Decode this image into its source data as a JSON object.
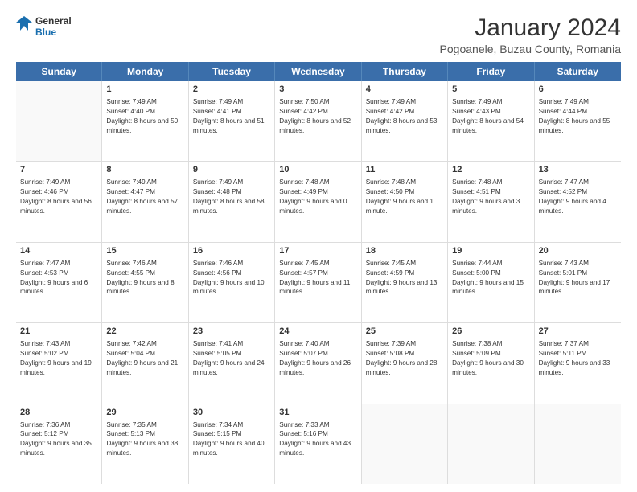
{
  "header": {
    "logo_line1": "General",
    "logo_line2": "Blue",
    "month": "January 2024",
    "location": "Pogoanele, Buzau County, Romania"
  },
  "days_of_week": [
    "Sunday",
    "Monday",
    "Tuesday",
    "Wednesday",
    "Thursday",
    "Friday",
    "Saturday"
  ],
  "weeks": [
    [
      {
        "day": "",
        "sunrise": "",
        "sunset": "",
        "daylight": ""
      },
      {
        "day": "1",
        "sunrise": "Sunrise: 7:49 AM",
        "sunset": "Sunset: 4:40 PM",
        "daylight": "Daylight: 8 hours and 50 minutes."
      },
      {
        "day": "2",
        "sunrise": "Sunrise: 7:49 AM",
        "sunset": "Sunset: 4:41 PM",
        "daylight": "Daylight: 8 hours and 51 minutes."
      },
      {
        "day": "3",
        "sunrise": "Sunrise: 7:50 AM",
        "sunset": "Sunset: 4:42 PM",
        "daylight": "Daylight: 8 hours and 52 minutes."
      },
      {
        "day": "4",
        "sunrise": "Sunrise: 7:49 AM",
        "sunset": "Sunset: 4:42 PM",
        "daylight": "Daylight: 8 hours and 53 minutes."
      },
      {
        "day": "5",
        "sunrise": "Sunrise: 7:49 AM",
        "sunset": "Sunset: 4:43 PM",
        "daylight": "Daylight: 8 hours and 54 minutes."
      },
      {
        "day": "6",
        "sunrise": "Sunrise: 7:49 AM",
        "sunset": "Sunset: 4:44 PM",
        "daylight": "Daylight: 8 hours and 55 minutes."
      }
    ],
    [
      {
        "day": "7",
        "sunrise": "Sunrise: 7:49 AM",
        "sunset": "Sunset: 4:46 PM",
        "daylight": "Daylight: 8 hours and 56 minutes."
      },
      {
        "day": "8",
        "sunrise": "Sunrise: 7:49 AM",
        "sunset": "Sunset: 4:47 PM",
        "daylight": "Daylight: 8 hours and 57 minutes."
      },
      {
        "day": "9",
        "sunrise": "Sunrise: 7:49 AM",
        "sunset": "Sunset: 4:48 PM",
        "daylight": "Daylight: 8 hours and 58 minutes."
      },
      {
        "day": "10",
        "sunrise": "Sunrise: 7:48 AM",
        "sunset": "Sunset: 4:49 PM",
        "daylight": "Daylight: 9 hours and 0 minutes."
      },
      {
        "day": "11",
        "sunrise": "Sunrise: 7:48 AM",
        "sunset": "Sunset: 4:50 PM",
        "daylight": "Daylight: 9 hours and 1 minute."
      },
      {
        "day": "12",
        "sunrise": "Sunrise: 7:48 AM",
        "sunset": "Sunset: 4:51 PM",
        "daylight": "Daylight: 9 hours and 3 minutes."
      },
      {
        "day": "13",
        "sunrise": "Sunrise: 7:47 AM",
        "sunset": "Sunset: 4:52 PM",
        "daylight": "Daylight: 9 hours and 4 minutes."
      }
    ],
    [
      {
        "day": "14",
        "sunrise": "Sunrise: 7:47 AM",
        "sunset": "Sunset: 4:53 PM",
        "daylight": "Daylight: 9 hours and 6 minutes."
      },
      {
        "day": "15",
        "sunrise": "Sunrise: 7:46 AM",
        "sunset": "Sunset: 4:55 PM",
        "daylight": "Daylight: 9 hours and 8 minutes."
      },
      {
        "day": "16",
        "sunrise": "Sunrise: 7:46 AM",
        "sunset": "Sunset: 4:56 PM",
        "daylight": "Daylight: 9 hours and 10 minutes."
      },
      {
        "day": "17",
        "sunrise": "Sunrise: 7:45 AM",
        "sunset": "Sunset: 4:57 PM",
        "daylight": "Daylight: 9 hours and 11 minutes."
      },
      {
        "day": "18",
        "sunrise": "Sunrise: 7:45 AM",
        "sunset": "Sunset: 4:59 PM",
        "daylight": "Daylight: 9 hours and 13 minutes."
      },
      {
        "day": "19",
        "sunrise": "Sunrise: 7:44 AM",
        "sunset": "Sunset: 5:00 PM",
        "daylight": "Daylight: 9 hours and 15 minutes."
      },
      {
        "day": "20",
        "sunrise": "Sunrise: 7:43 AM",
        "sunset": "Sunset: 5:01 PM",
        "daylight": "Daylight: 9 hours and 17 minutes."
      }
    ],
    [
      {
        "day": "21",
        "sunrise": "Sunrise: 7:43 AM",
        "sunset": "Sunset: 5:02 PM",
        "daylight": "Daylight: 9 hours and 19 minutes."
      },
      {
        "day": "22",
        "sunrise": "Sunrise: 7:42 AM",
        "sunset": "Sunset: 5:04 PM",
        "daylight": "Daylight: 9 hours and 21 minutes."
      },
      {
        "day": "23",
        "sunrise": "Sunrise: 7:41 AM",
        "sunset": "Sunset: 5:05 PM",
        "daylight": "Daylight: 9 hours and 24 minutes."
      },
      {
        "day": "24",
        "sunrise": "Sunrise: 7:40 AM",
        "sunset": "Sunset: 5:07 PM",
        "daylight": "Daylight: 9 hours and 26 minutes."
      },
      {
        "day": "25",
        "sunrise": "Sunrise: 7:39 AM",
        "sunset": "Sunset: 5:08 PM",
        "daylight": "Daylight: 9 hours and 28 minutes."
      },
      {
        "day": "26",
        "sunrise": "Sunrise: 7:38 AM",
        "sunset": "Sunset: 5:09 PM",
        "daylight": "Daylight: 9 hours and 30 minutes."
      },
      {
        "day": "27",
        "sunrise": "Sunrise: 7:37 AM",
        "sunset": "Sunset: 5:11 PM",
        "daylight": "Daylight: 9 hours and 33 minutes."
      }
    ],
    [
      {
        "day": "28",
        "sunrise": "Sunrise: 7:36 AM",
        "sunset": "Sunset: 5:12 PM",
        "daylight": "Daylight: 9 hours and 35 minutes."
      },
      {
        "day": "29",
        "sunrise": "Sunrise: 7:35 AM",
        "sunset": "Sunset: 5:13 PM",
        "daylight": "Daylight: 9 hours and 38 minutes."
      },
      {
        "day": "30",
        "sunrise": "Sunrise: 7:34 AM",
        "sunset": "Sunset: 5:15 PM",
        "daylight": "Daylight: 9 hours and 40 minutes."
      },
      {
        "day": "31",
        "sunrise": "Sunrise: 7:33 AM",
        "sunset": "Sunset: 5:16 PM",
        "daylight": "Daylight: 9 hours and 43 minutes."
      },
      {
        "day": "",
        "sunrise": "",
        "sunset": "",
        "daylight": ""
      },
      {
        "day": "",
        "sunrise": "",
        "sunset": "",
        "daylight": ""
      },
      {
        "day": "",
        "sunrise": "",
        "sunset": "",
        "daylight": ""
      }
    ]
  ]
}
